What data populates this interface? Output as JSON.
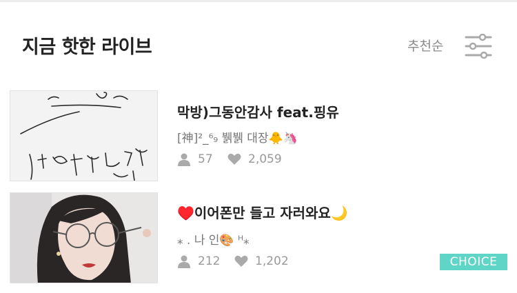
{
  "header": {
    "title": "지금 핫한 라이브",
    "sort_label": "추천순",
    "filter_icon": "sliders-icon"
  },
  "items": [
    {
      "title": "막방)그동안감사 feat.핑유",
      "subtitle": "[神]²_⁶₉ 뷁뷁 대장🐥🦄",
      "viewers": "57",
      "likes": "2,059",
      "thumbnail": "handwriting-note-image"
    },
    {
      "title": "♥️이어폰만 들고 자러와요🌙",
      "subtitle": "⁎ . 나 인🎨 ᴴ⁎",
      "viewers": "212",
      "likes": "1,202",
      "badge": "CHOICE",
      "thumbnail": "portrait-with-glasses-image"
    }
  ],
  "colors": {
    "badge": "#5fd5c7",
    "meta_gray": "#999999"
  }
}
